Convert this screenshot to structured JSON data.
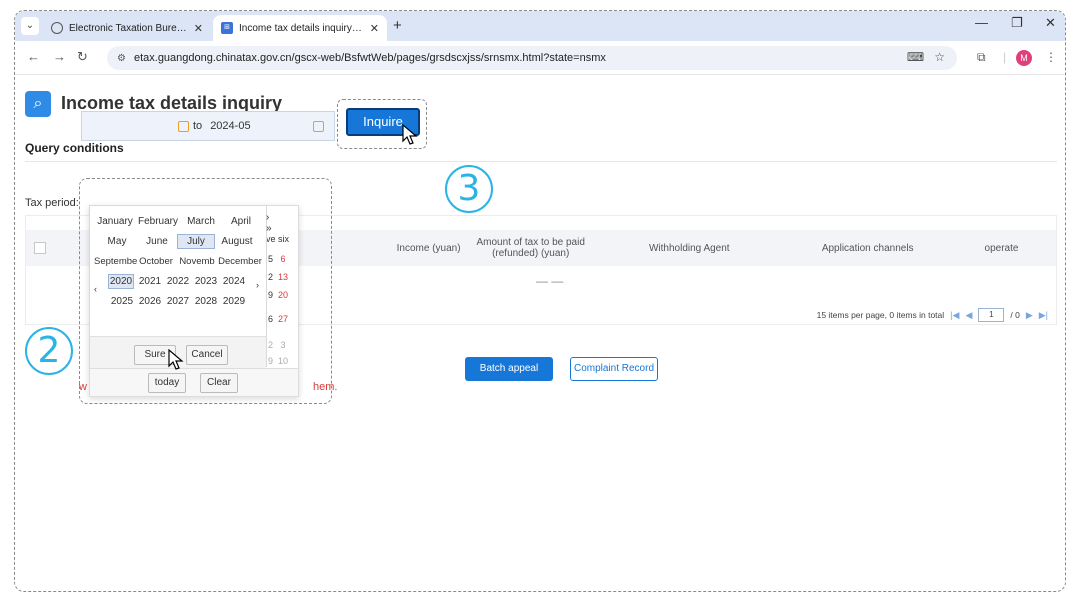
{
  "browser": {
    "tabs": [
      {
        "title": "Electronic Taxation Bureau fo",
        "active": false
      },
      {
        "title": "Income tax details inquiry an",
        "active": true
      }
    ],
    "url": "etax.guangdong.chinatax.gov.cn/gscx-web/BsfwtWeb/pages/grsdscxjss/srnsmx.html?state=nsmx",
    "profile_initial": "M"
  },
  "page": {
    "title": "Income tax details inquiry",
    "section_title": "Query conditions",
    "tax_period_label": "Tax period:",
    "range_separator": "to",
    "end_date": "2024-05",
    "inquire_label": "Inquire",
    "table": {
      "headers": [
        "Income (yuan)",
        "Amount of tax to be paid (refunded) (yuan)",
        "Withholding Agent",
        "Application channels",
        "operate"
      ],
      "empty_text": "— —"
    },
    "pager": {
      "summary": "15 items per page, 0 items in total",
      "current_page": "1",
      "total_pages": "/ 0"
    },
    "batch_appeal_label": "Batch appeal",
    "complaint_record_label": "Complaint Record",
    "warning_text_start": "w",
    "warning_text_end": "hem."
  },
  "month_picker": {
    "nav_right": "› »",
    "months_row1": [
      "January",
      "February",
      "March",
      "April"
    ],
    "months_row2": [
      "May",
      "June",
      "July",
      "August"
    ],
    "months_row3": [
      "Septembe",
      "October",
      "Novemb",
      "December"
    ],
    "selected_month": "July",
    "years_row1": [
      "2020",
      "2021",
      "2022",
      "2023",
      "2024"
    ],
    "years_row2": [
      "2025",
      "2026",
      "2027",
      "2028",
      "2029"
    ],
    "selected_year": "2020",
    "prev": "‹",
    "next": "›",
    "sure_label": "Sure",
    "cancel_label": "Cancel"
  },
  "day_picker_partial": {
    "week_header": "ve six",
    "rows": [
      {
        "a": "5",
        "b": "6"
      },
      {
        "a": "2",
        "b": "13"
      },
      {
        "a": "9",
        "b": "20"
      },
      {
        "a": "6",
        "b": "27"
      },
      {
        "a": "2",
        "b": "3"
      },
      {
        "a": "9",
        "b": "10"
      }
    ],
    "today_label": "today",
    "clear_label": "Clear"
  },
  "annotations": {
    "step2": "2",
    "step3": "3"
  },
  "colors": {
    "accent": "#1677d9",
    "step_circle": "#2bb3e6",
    "warning": "#d43c3c",
    "weekend_red": "#d43c3c"
  }
}
